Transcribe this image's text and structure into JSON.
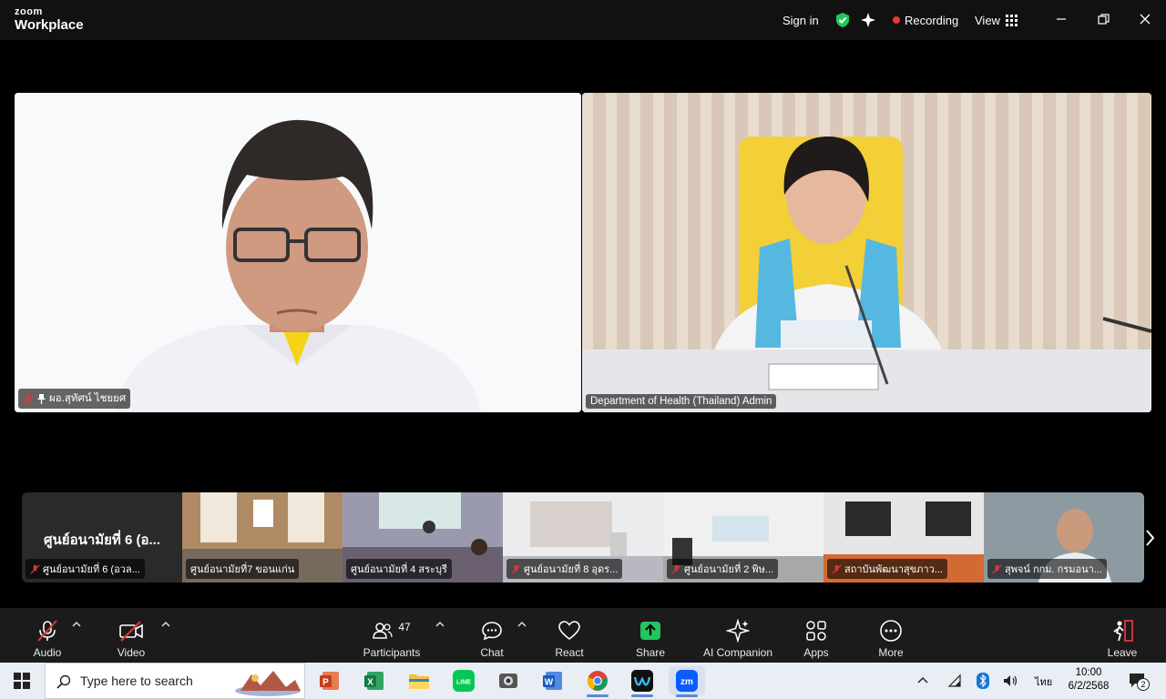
{
  "app": {
    "logo_line1": "zoom",
    "logo_line2": "Workplace"
  },
  "titlebar": {
    "sign_in": "Sign in",
    "recording": "Recording",
    "view": "View"
  },
  "speakers": [
    {
      "name": "ผอ.สุทัศน์ ไชยยศ"
    },
    {
      "name": "Department of Health (Thailand) Admin"
    }
  ],
  "strip": {
    "first_card_title": "ศูนย์อนามัยที่ 6 (อ...",
    "thumbnails": [
      {
        "name": "ศูนย์อนามัยที่ 6 (อวล..."
      },
      {
        "name": "ศูนย์อนามัยที่7 ขอนแก่น"
      },
      {
        "name": "ศูนย์อนามัยที่ 4 สระบุรี"
      },
      {
        "name": "ศูนย์อนามัยที่ 8 อุดร..."
      },
      {
        "name": "ศูนย์อนามัยที่ 2 พิษ..."
      },
      {
        "name": "สถาบันพัฒนาสุขภาว..."
      },
      {
        "name": "สุพจน์ กกม. กรมอนา..."
      }
    ]
  },
  "toolbar": {
    "audio": "Audio",
    "video": "Video",
    "participants": "Participants",
    "participants_count": "47",
    "chat": "Chat",
    "react": "React",
    "share": "Share",
    "ai_companion": "AI Companion",
    "apps": "Apps",
    "more": "More",
    "leave": "Leave"
  },
  "taskbar": {
    "search_placeholder": "Type here to search",
    "lang": "ไทย",
    "time": "10:00",
    "date": "6/2/2568",
    "notifications": "2"
  },
  "colors": {
    "accent_green": "#22c55e",
    "recording_red": "#e53935",
    "muted_red": "#e0353b"
  }
}
